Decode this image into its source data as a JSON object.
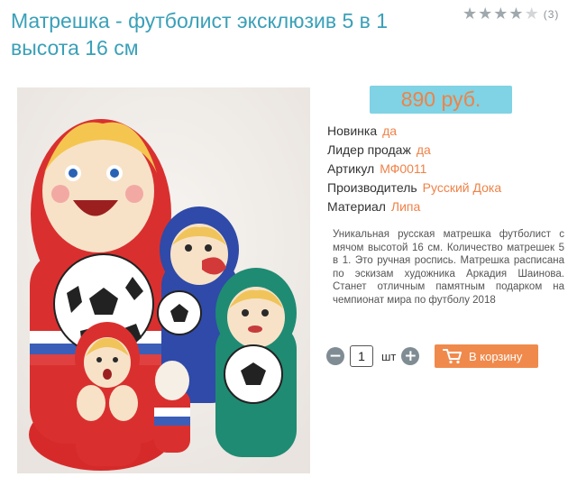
{
  "product": {
    "title": "Матрешка - футболист эксклюзив 5 в 1 высота 16 см",
    "rating": {
      "stars": 4,
      "max": 5,
      "count_label": "(3)"
    },
    "price": "890 руб.",
    "properties": [
      {
        "label": "Новинка",
        "value": "да"
      },
      {
        "label": "Лидер продаж",
        "value": "да"
      },
      {
        "label": "Артикул",
        "value": "МФ0011"
      },
      {
        "label": "Производитель",
        "value": "Русский Дока"
      },
      {
        "label": "Материал",
        "value": "Липа"
      }
    ],
    "description": "Уникальная русская матрешка футболист с мячом высотой 16 см. Количество матрешек 5 в 1. Это ручная роспись. Матрешка расписана по эскизам художника Аркадия Шаинова. Станет отличным памятным подарком на чемпионат мира по футболу 2018"
  },
  "purchase": {
    "quantity": "1",
    "unit": "шт",
    "minus_icon": "minus-icon",
    "plus_icon": "plus-icon",
    "cart_icon": "cart-icon",
    "cart_label": "В корзину"
  },
  "colors": {
    "title": "#3aa0b8",
    "price_bg": "#7fd3e4",
    "accent": "#ef8248",
    "cart_button": "#f08a4c"
  }
}
